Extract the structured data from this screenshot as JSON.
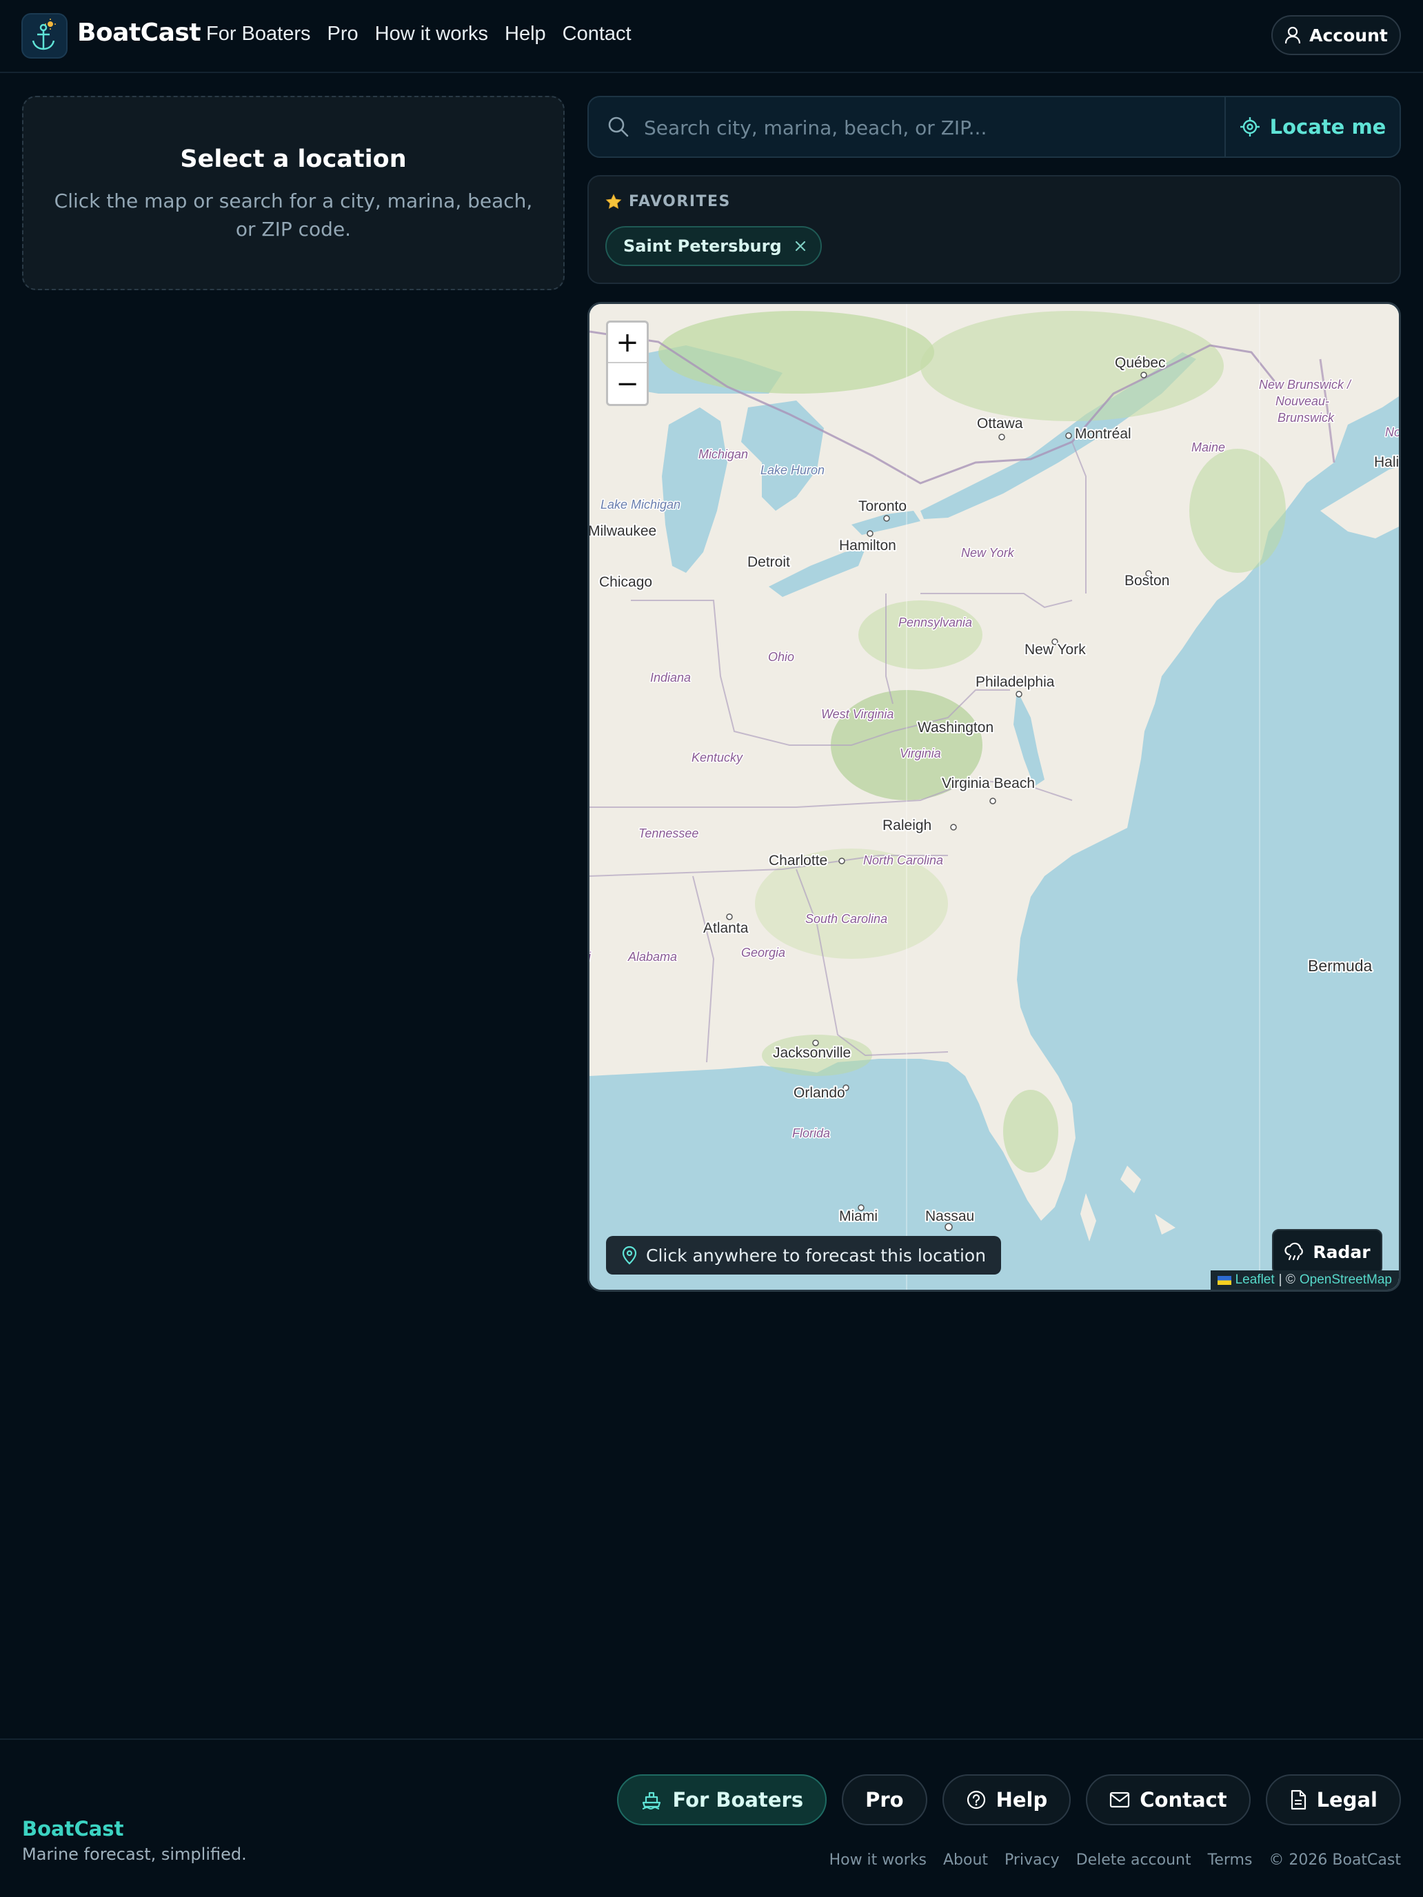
{
  "header": {
    "brand": "BoatCast",
    "nav": [
      "For Boaters",
      "Pro",
      "How it works",
      "Help",
      "Contact"
    ],
    "account_label": "Account"
  },
  "empty_state": {
    "title": "Select a location",
    "description": "Click the map or search for a city, marina, beach, or ZIP code."
  },
  "search": {
    "placeholder": "Search city, marina, beach, or ZIP...",
    "value": "",
    "locate_label": "Locate me"
  },
  "favorites": {
    "heading": "FAVORITES",
    "items": [
      "Saint Petersburg"
    ]
  },
  "map": {
    "zoom_in": "+",
    "zoom_out": "−",
    "hint": "Click anywhere to forecast this location",
    "radar_label": "Radar",
    "attribution": {
      "leaflet": "Leaflet",
      "separator": "| ©",
      "osm": "OpenStreetMap"
    },
    "labels": {
      "cities": [
        "Québec",
        "Ottawa",
        "Montréal",
        "Toronto",
        "Hamilton",
        "Milwaukee",
        "Detroit",
        "Chicago",
        "Boston",
        "New York",
        "Philadelphia",
        "Washington",
        "Virginia Beach",
        "Raleigh",
        "Charlotte",
        "Atlanta",
        "Jacksonville",
        "Orlando",
        "Miami",
        "Nassau",
        "Halifa",
        "Bermuda",
        "amas"
      ],
      "regions": [
        "Michigan",
        "Lake Huron",
        "Lake Michigan",
        "New York",
        "Maine",
        "New Brunswick /",
        "Nouveau-",
        "Brunswick",
        "No",
        "Pennsylvania",
        "Ohio",
        "Indiana",
        "West Virginia",
        "Virginia",
        "Kentucky",
        "Tennessee",
        "North Carolina",
        "South Carolina",
        "Georgia",
        "Alabama",
        "Florida",
        "i"
      ]
    }
  },
  "footer": {
    "brand": "BoatCast",
    "tagline": "Marine forecast, simplified.",
    "buttons": [
      "For Boaters",
      "Pro",
      "Help",
      "Contact",
      "Legal"
    ],
    "links": [
      "How it works",
      "About",
      "Privacy",
      "Delete account",
      "Terms",
      "© 2026 BoatCast"
    ]
  },
  "colors": {
    "background": "#040f18",
    "accent": "#3cd3c2",
    "water": "#abd3df",
    "land": "#f0ede5"
  }
}
